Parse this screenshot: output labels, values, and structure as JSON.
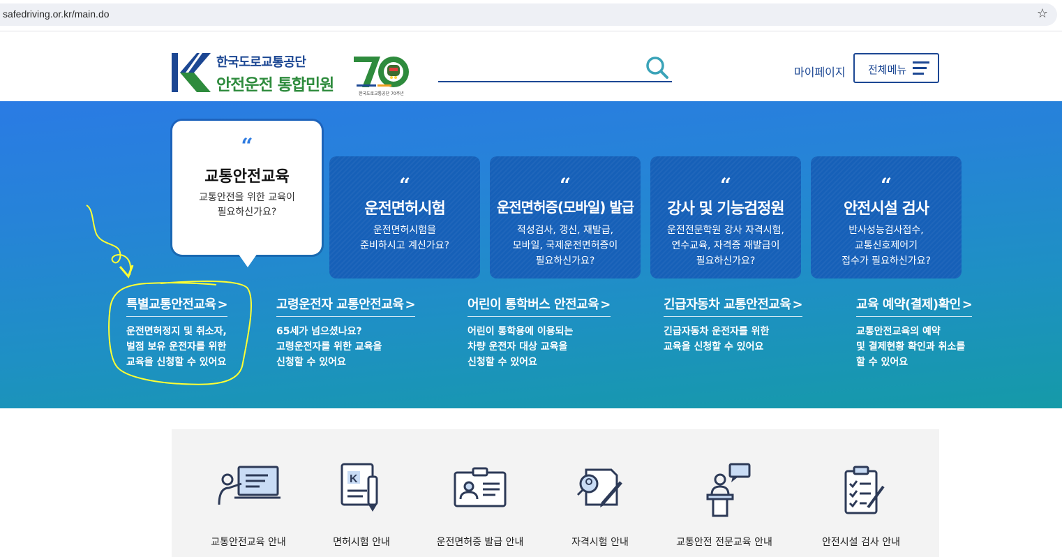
{
  "browser": {
    "url": "safedriving.or.kr/main.do"
  },
  "header": {
    "org_name": "한국도로교통공단",
    "site_name": "안전운전 통합민원",
    "anniv_caption": "한국도로교통공단 70주년",
    "mypage_label": "마이페이지",
    "allmenu_label": "전체메뉴"
  },
  "hero": {
    "featured": {
      "quote": "“",
      "title": "교통안전교육",
      "desc_line1": "교통안전을 위한 교육이",
      "desc_line2": "필요하신가요?"
    },
    "cards": [
      {
        "quote": "“",
        "title": "운전면허시험",
        "lines": [
          "운전면허시험을",
          "준비하시고 계신가요?"
        ]
      },
      {
        "quote": "“",
        "title": "운전면허증(모바일) 발급",
        "lines": [
          "적성검사, 갱신, 재발급,",
          "모바일, 국제운전면허증이",
          "필요하신가요?"
        ]
      },
      {
        "quote": "“",
        "title": "강사 및 기능검정원",
        "lines": [
          "운전전문학원 강사 자격시험,",
          "연수교육, 자격증 재발급이",
          "필요하신가요?"
        ]
      },
      {
        "quote": "“",
        "title": "안전시설 검사",
        "lines": [
          "반사성능검사접수,",
          "교통신호제어기",
          "접수가 필요하신가요?"
        ]
      }
    ],
    "links": [
      {
        "title": "특별교통안전교육",
        "arrow": ">",
        "lines": [
          "운전면허정지 및 취소자,",
          "벌점 보유 운전자를 위한",
          "교육을 신청할 수 있어요"
        ]
      },
      {
        "title": "고령운전자 교통안전교육",
        "arrow": ">",
        "lines": [
          "65세가 넘으셨나요?",
          "고령운전자를 위한 교육을",
          "신청할 수 있어요"
        ]
      },
      {
        "title": "어린이 통학버스 안전교육",
        "arrow": ">",
        "lines": [
          "어린이 통학용에 이용되는",
          "차량 운전자 대상 교육을",
          "신청할 수 있어요"
        ]
      },
      {
        "title": "긴급자동차 교통안전교육",
        "arrow": ">",
        "lines": [
          "긴급자동차 운전자를 위한",
          "교육을 신청할 수 있어요"
        ]
      },
      {
        "title": "교육 예약(결제)확인",
        "arrow": ">",
        "lines": [
          "교통안전교육의 예약",
          "및 결제현황 확인과 취소를",
          "할 수 있어요"
        ]
      }
    ]
  },
  "services": [
    {
      "label": "교통안전교육 안내",
      "icon": "lecture-icon"
    },
    {
      "label": "면허시험 안내",
      "icon": "license-doc-icon"
    },
    {
      "label": "운전면허증 발급 안내",
      "icon": "id-card-icon"
    },
    {
      "label": "자격시험 안내",
      "icon": "exam-icon"
    },
    {
      "label": "교통안전 전문교육 안내",
      "icon": "speaker-icon"
    },
    {
      "label": "안전시설 검사 안내",
      "icon": "checklist-icon"
    }
  ],
  "colors": {
    "brand_blue": "#1c4793",
    "brand_green": "#2e8b3d",
    "card_blue": "#1660b8",
    "highlight": "#ffff33"
  }
}
